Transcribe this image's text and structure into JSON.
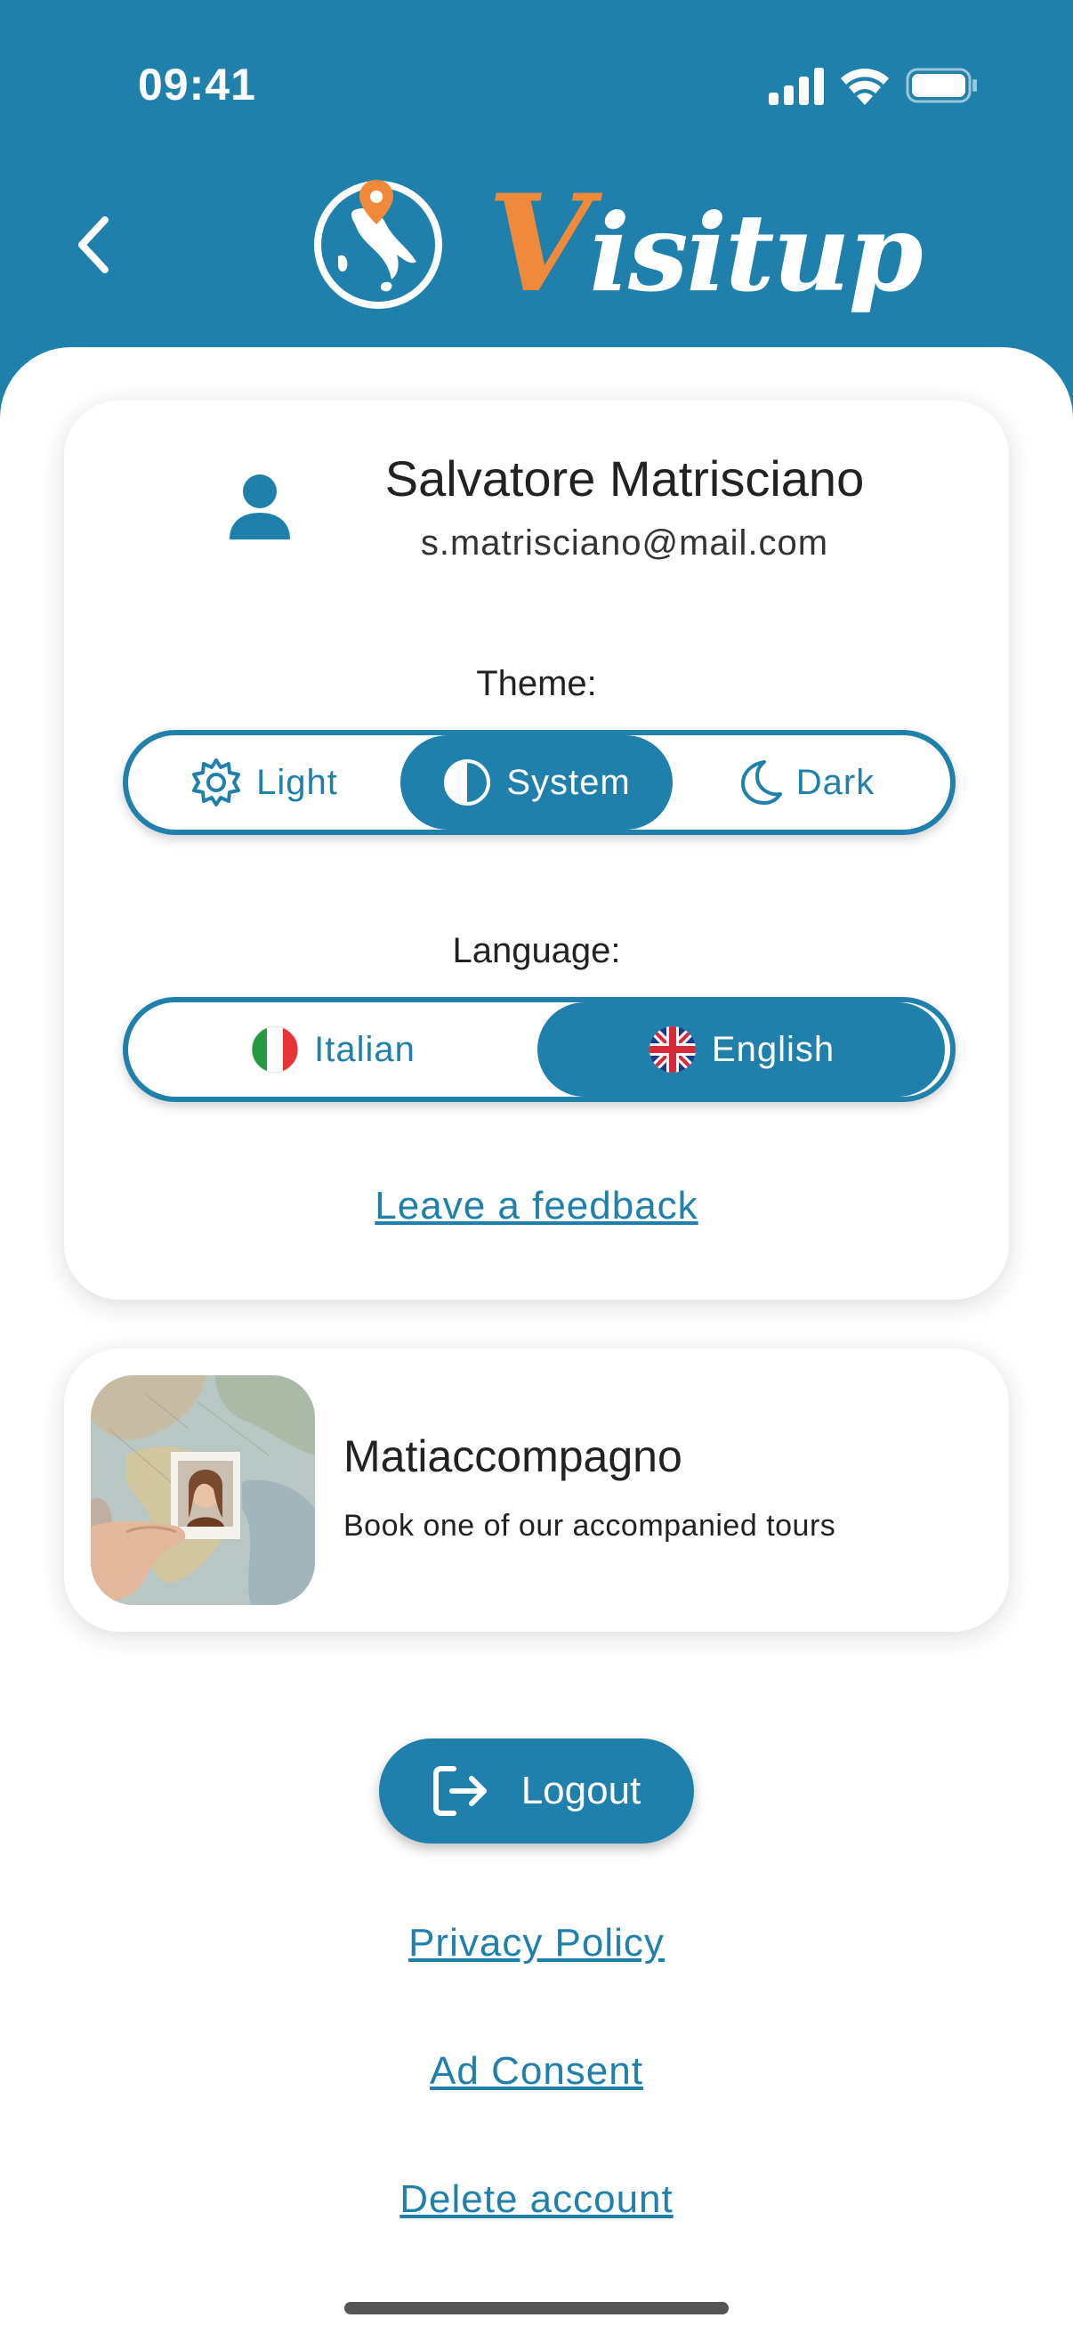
{
  "status_bar": {
    "time": "09:41",
    "icons": [
      "cellular-signal-icon",
      "wifi-icon",
      "battery-icon"
    ]
  },
  "header": {
    "back_icon": "chevron-left-icon",
    "logo_icon": "italy-globe-pin-icon",
    "brand_first_letter": "V",
    "brand_rest": "isitup"
  },
  "colors": {
    "primary": "#2080AC",
    "accent": "#F08A3A",
    "background": "#FFFFFF",
    "text": "#222222"
  },
  "profile": {
    "name": "Salvatore Matrisciano",
    "email": "s.matrisciano@mail.com",
    "icon": "user-icon"
  },
  "theme": {
    "label": "Theme:",
    "options": [
      {
        "label": "Light",
        "icon": "sun-gear-icon",
        "selected": false
      },
      {
        "label": "System",
        "icon": "half-circle-icon",
        "selected": true
      },
      {
        "label": "Dark",
        "icon": "moon-icon",
        "selected": false
      }
    ]
  },
  "language": {
    "label": "Language:",
    "options": [
      {
        "label": "Italian",
        "icon": "italy-flag-icon",
        "selected": false
      },
      {
        "label": "English",
        "icon": "uk-flag-icon",
        "selected": true
      }
    ]
  },
  "feedback_link": "Leave a feedback",
  "promo": {
    "title": "Matiaccompagno",
    "subtitle": "Book one of our accompanied tours"
  },
  "logout": {
    "label": "Logout",
    "icon": "logout-icon"
  },
  "links": {
    "privacy": "Privacy Policy",
    "ad_consent": "Ad Consent",
    "delete_account": "Delete account"
  }
}
